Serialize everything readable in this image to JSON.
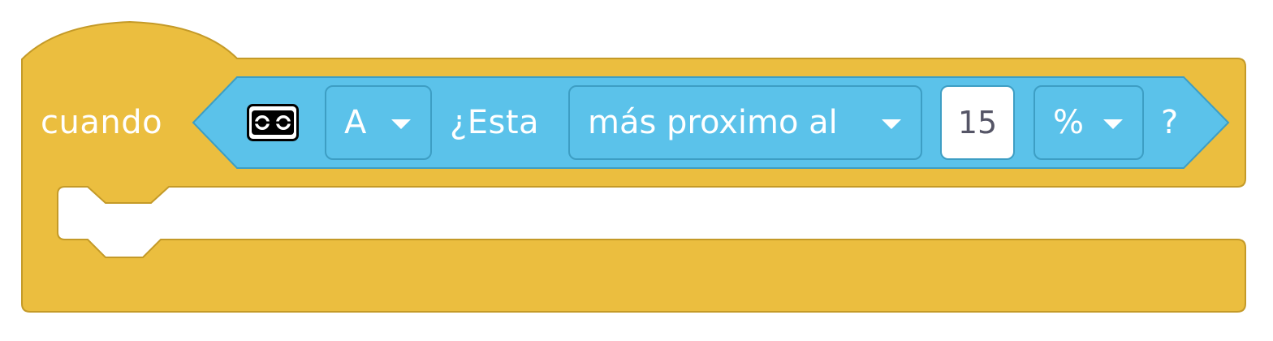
{
  "block": {
    "hat_label": "cuando",
    "sensor_icon": "distance-sensor-icon",
    "port_dropdown": {
      "selected": "A"
    },
    "question_label": "¿Esta",
    "comparison_dropdown": {
      "selected": "más proximo al"
    },
    "value_input": {
      "value": "15"
    },
    "unit_dropdown": {
      "selected": "%"
    },
    "end_label": "?",
    "colors": {
      "hat_block": "#ebbe3f",
      "hat_border": "#c49a28",
      "sensor_block": "#5bc2ea",
      "sensor_border": "#3d9ec4",
      "text": "#ffffff"
    }
  }
}
